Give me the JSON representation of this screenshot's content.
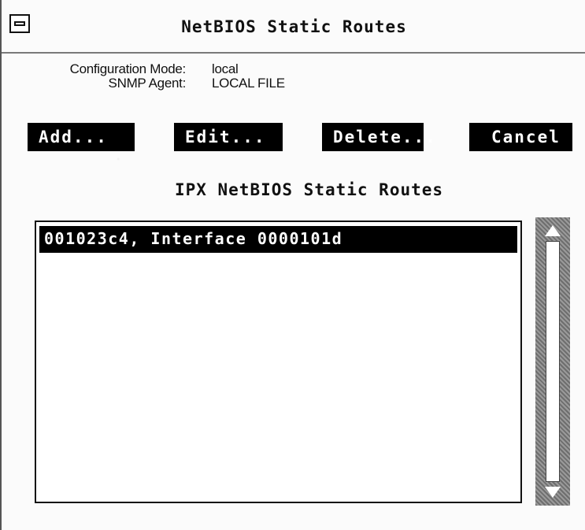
{
  "window": {
    "title": "NetBIOS Static Routes",
    "system_menu_icon": "system-menu-icon"
  },
  "info": {
    "config_mode_label": "Configuration Mode:",
    "config_mode_value": "local",
    "snmp_agent_label": "SNMP Agent:",
    "snmp_agent_value": "LOCAL FILE"
  },
  "buttons": {
    "add": "Add...",
    "edit": "Edit...",
    "delete": "Delete...",
    "cancel": "Cancel"
  },
  "routes": {
    "title": "IPX NetBIOS Static Routes",
    "items": [
      {
        "label": "001023c4, Interface 0000101d",
        "selected": true
      }
    ]
  },
  "scrollbar": {
    "up_icon": "up-arrow-icon",
    "down_icon": "down-arrow-icon"
  },
  "colors": {
    "button_bg": "#000000",
    "button_fg": "#ffffff",
    "selection_bg": "#000000"
  }
}
